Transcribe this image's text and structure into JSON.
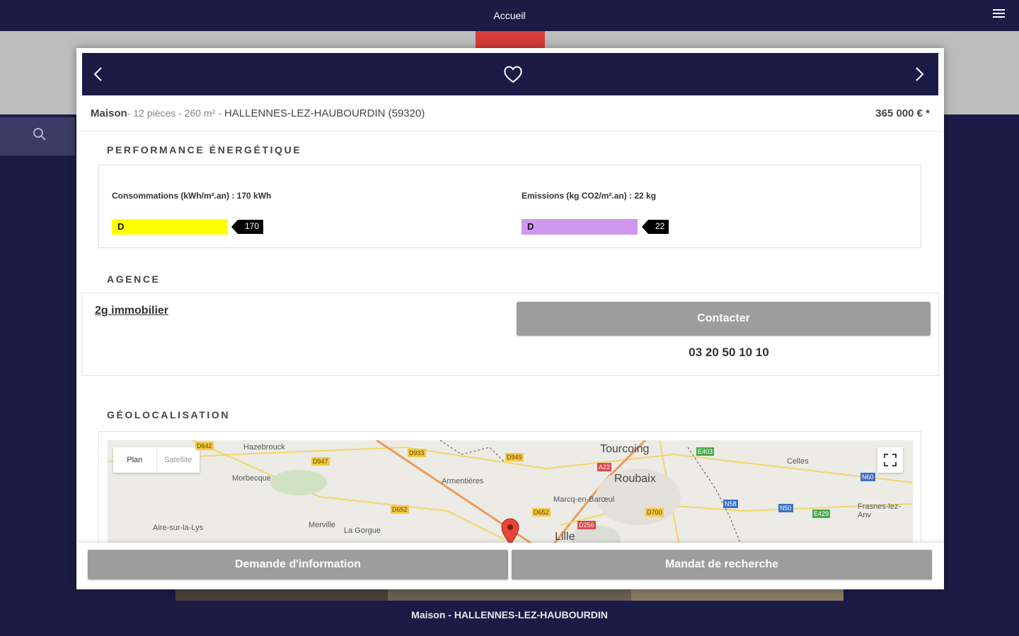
{
  "topbar": {
    "title": "Accueil",
    "menu_icon": "hamburger-menu-icon"
  },
  "colors": {
    "navy": "#1b1b46",
    "button_grey": "#9d9d9d",
    "energy_class_d": "#ffff00",
    "emission_class_d": "#cf97ee"
  },
  "modal": {
    "header": {
      "prev_icon": "chevron-left-icon",
      "favorite_icon": "heart-icon",
      "next_icon": "chevron-right-icon"
    },
    "summary": {
      "type": "Maison",
      "meta": "- 12 pièces - 260 m² -",
      "city": "HALLENNES-LEZ-HAUBOURDIN (59320)",
      "price": "365 000 € *"
    },
    "energy": {
      "title": "PERFORMANCE ÉNERGÉTIQUE",
      "consumption": {
        "label": "Consommations (kWh/m².an) : 170 kWh",
        "class": "D",
        "value": "170"
      },
      "emissions": {
        "label": "Emissions (kg CO2/m².an) : 22 kg",
        "class": "D",
        "value": "22"
      }
    },
    "agency": {
      "title": "AGENCE",
      "name": "2g immobilier",
      "contact_label": "Contacter",
      "phone": "03 20 50 10 10"
    },
    "geo": {
      "title": "GÉOLOCALISATION",
      "map_type_plan": "Plan",
      "map_type_satellite": "Satellite",
      "places": {
        "hazebrouck": "Hazebrouck",
        "tourcoing": "Tourcoing",
        "roubaix": "Roubaix",
        "celles": "Celles",
        "morbecque": "Morbecque",
        "armentieres": "Armentières",
        "marcq": "Marcq-en-Barœul",
        "aire": "Aire-sur-la-Lys",
        "merville": "Merville",
        "la_gorgue": "La Gorgue",
        "lille": "Lille",
        "frasnes": "Frasnes-lez-Anv"
      },
      "roads": [
        "D642",
        "D933",
        "D947",
        "D949",
        "A22",
        "E403",
        "N60",
        "N58",
        "N50",
        "E429",
        "D652",
        "D652",
        "D700",
        "D256"
      ]
    },
    "footer": {
      "info_label": "Demande d'information",
      "mandate_label": "Mandat de recherche"
    }
  },
  "caption": "Maison - HALLENNES-LEZ-HAUBOURDIN"
}
